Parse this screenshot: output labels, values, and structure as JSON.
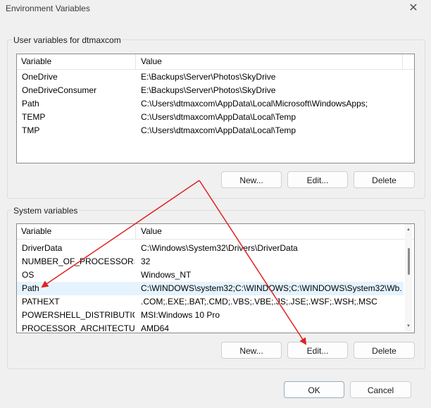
{
  "window": {
    "title": "Environment Variables",
    "close_glyph": "✕"
  },
  "user_group": {
    "label": "User variables for dtmaxcom",
    "columns": [
      "Variable",
      "Value"
    ],
    "rows": [
      {
        "variable": "OneDrive",
        "value": "E:\\Backups\\Server\\Photos\\SkyDrive"
      },
      {
        "variable": "OneDriveConsumer",
        "value": "E:\\Backups\\Server\\Photos\\SkyDrive"
      },
      {
        "variable": "Path",
        "value": "C:\\Users\\dtmaxcom\\AppData\\Local\\Microsoft\\WindowsApps;"
      },
      {
        "variable": "TEMP",
        "value": "C:\\Users\\dtmaxcom\\AppData\\Local\\Temp"
      },
      {
        "variable": "TMP",
        "value": "C:\\Users\\dtmaxcom\\AppData\\Local\\Temp"
      }
    ],
    "buttons": {
      "new": "New...",
      "edit": "Edit...",
      "delete": "Delete"
    }
  },
  "system_group": {
    "label": "System variables",
    "columns": [
      "Variable",
      "Value"
    ],
    "rows": [
      {
        "variable": "DriverData",
        "value": "C:\\Windows\\System32\\Drivers\\DriverData"
      },
      {
        "variable": "NUMBER_OF_PROCESSORS",
        "value": "32"
      },
      {
        "variable": "OS",
        "value": "Windows_NT"
      },
      {
        "variable": "Path",
        "value": "C:\\WINDOWS\\system32;C:\\WINDOWS;C:\\WINDOWS\\System32\\Wb..."
      },
      {
        "variable": "PATHEXT",
        "value": ".COM;.EXE;.BAT;.CMD;.VBS;.VBE;.JS;.JSE;.WSF;.WSH;.MSC"
      },
      {
        "variable": "POWERSHELL_DISTRIBUTIO...",
        "value": "MSI:Windows 10 Pro"
      },
      {
        "variable": "PROCESSOR_ARCHITECTURE",
        "value": "AMD64"
      }
    ],
    "buttons": {
      "new": "New...",
      "edit": "Edit...",
      "delete": "Delete"
    }
  },
  "footer": {
    "ok": "OK",
    "cancel": "Cancel"
  },
  "colors": {
    "annotation_arrow": "#e02020",
    "selected_row": "#e5f3ff"
  }
}
